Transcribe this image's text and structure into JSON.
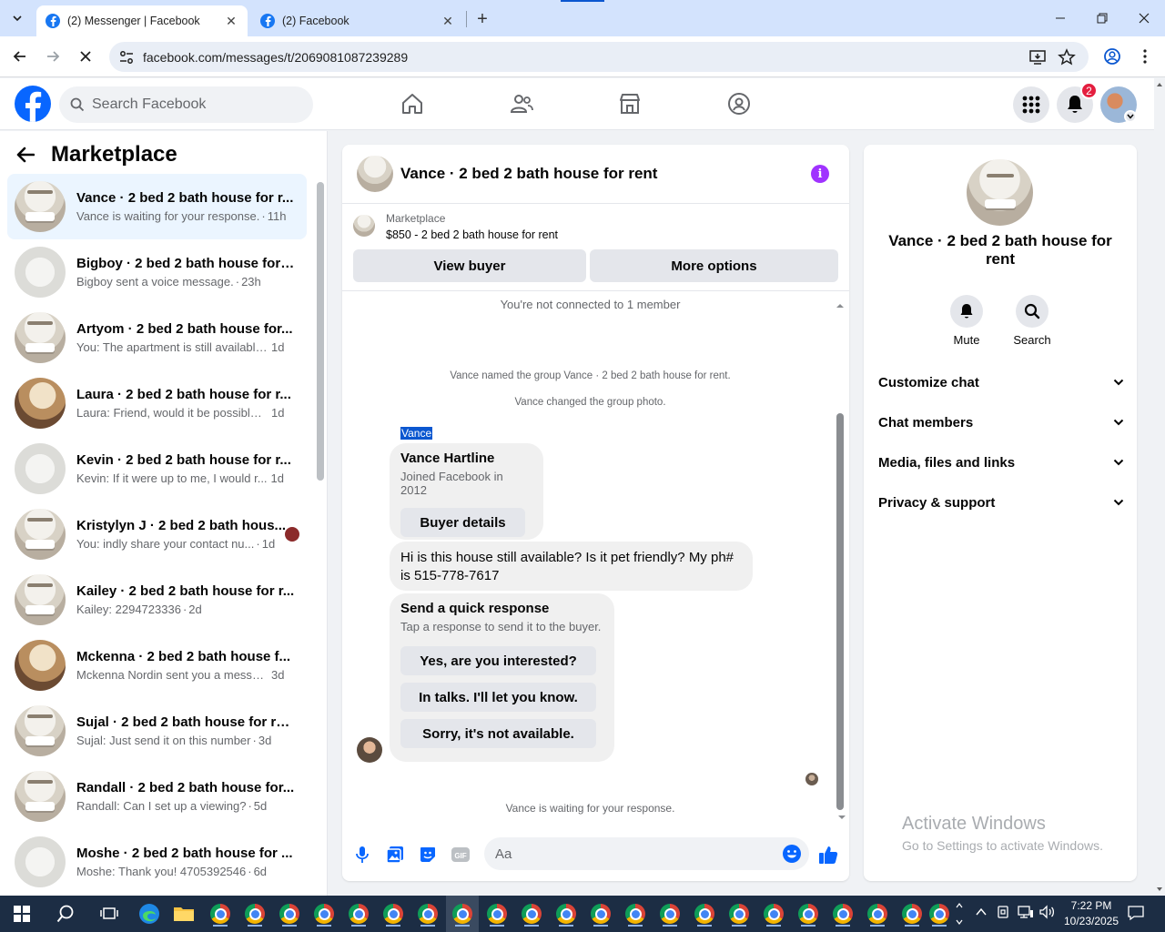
{
  "browser": {
    "tabs": [
      {
        "title": "(2) Messenger | Facebook",
        "active": true
      },
      {
        "title": "(2) Facebook",
        "active": false
      }
    ],
    "url": "facebook.com/messages/t/2069081087239289"
  },
  "fb": {
    "search_placeholder": "Search Facebook",
    "notification_count": "2",
    "brand_color": "#0866ff"
  },
  "sidebar": {
    "title": "Marketplace",
    "conversations": [
      {
        "title": "Vance · 2 bed 2 bath house for r...",
        "message": "Vance is waiting for your response.",
        "time": "11h",
        "active": true
      },
      {
        "title": "Bigboy · 2 bed 2 bath house for ...",
        "message": "Bigboy sent a voice message.",
        "time": "23h"
      },
      {
        "title": "Artyom · 2 bed 2 bath house for...",
        "message": "You: The apartment is still available ...",
        "time": "1d"
      },
      {
        "title": "Laura · 2 bed 2 bath house for r...",
        "message": "Laura: Friend, would it be possible t...",
        "time": "1d"
      },
      {
        "title": "Kevin · 2 bed 2 bath house for r...",
        "message": "Kevin: If it were up to me, I would r...",
        "time": "1d"
      },
      {
        "title": "Kristylyn J · 2 bed 2 bath hous...",
        "message": "You: indly share your contact nu...",
        "time": "1d"
      },
      {
        "title": "Kailey · 2 bed 2 bath house for r...",
        "message": "Kailey: 2294723336",
        "time": "2d"
      },
      {
        "title": "Mckenna · 2 bed 2 bath house f...",
        "message": "Mckenna Nordin sent you a messa...",
        "time": "3d"
      },
      {
        "title": "Sujal · 2 bed 2 bath house for rent",
        "message": "Sujal: Just send it on this number",
        "time": "3d"
      },
      {
        "title": "Randall · 2 bed 2 bath house for...",
        "message": "Randall: Can I set up a viewing?",
        "time": "5d"
      },
      {
        "title": "Moshe · 2 bed 2 bath house for ...",
        "message": "Moshe: Thank you! 4705392546",
        "time": "6d"
      }
    ]
  },
  "chat": {
    "title": "Vance · 2 bed 2 bath house for rent",
    "marketplace_label": "Marketplace",
    "listing": "$850 - 2 bed 2 bath house for rent",
    "view_buyer": "View buyer",
    "more_options": "More options",
    "not_connected": "You're not connected to 1 member",
    "named_group": "Vance named the group Vance · 2 bed 2 bath house for rent.",
    "changed_photo": "Vance changed the group photo.",
    "sender_label": "Vance",
    "profile_card": {
      "name": "Vance Hartline",
      "joined": "Joined Facebook in 2012",
      "button": "Buyer details"
    },
    "message": "Hi is this house still available? Is it pet friendly? My ph# is 515-778-7617",
    "quick": {
      "title": "Send a quick response",
      "subtitle": "Tap a response to send it to the buyer.",
      "options": [
        "Yes, are you interested?",
        "In talks. I'll let you know.",
        "Sorry, it's not available."
      ]
    },
    "waiting": "Vance is waiting for your response.",
    "composer_placeholder": "Aa",
    "info_icon": "info-icon",
    "accent": "#a033ff"
  },
  "details": {
    "name": "Vance · 2 bed 2 bath house for rent",
    "mute": "Mute",
    "search": "Search",
    "sections": [
      "Customize chat",
      "Chat members",
      "Media, files and links",
      "Privacy & support"
    ]
  },
  "watermark": {
    "line1": "Activate Windows",
    "line2": "Go to Settings to activate Windows."
  },
  "taskbar": {
    "time": "7:22 PM",
    "date": "10/23/2025"
  }
}
